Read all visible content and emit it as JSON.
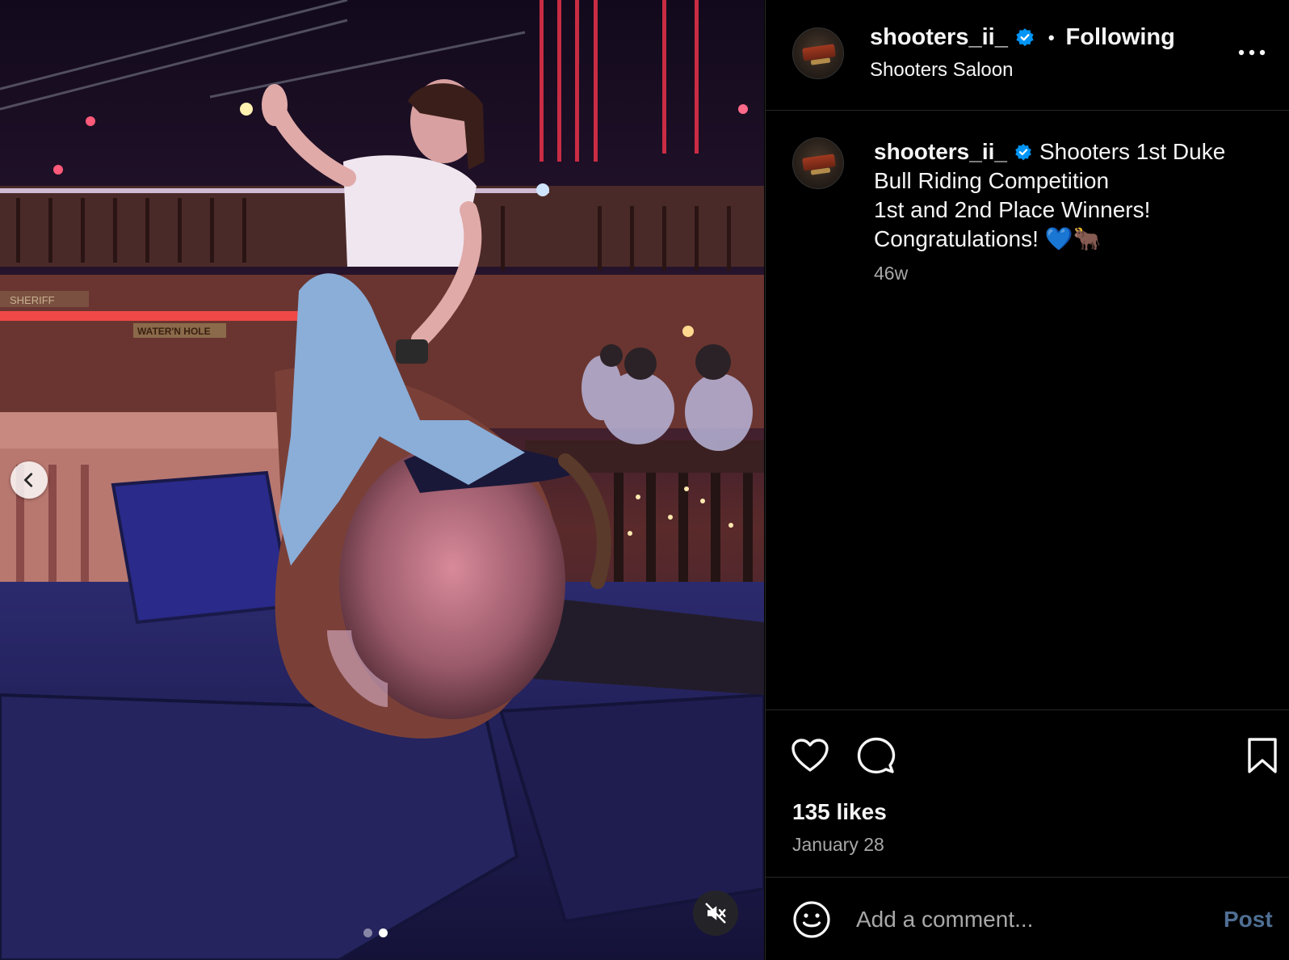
{
  "post": {
    "media": {
      "description_icon": "video-frame",
      "prev_icon": "chevron-left-icon",
      "mute_icon": "speaker-muted-icon",
      "dots": {
        "count": 2,
        "active_index": 1
      },
      "sign_texts": [
        "SHERIFF",
        "WATER'N HOLE"
      ]
    },
    "header": {
      "username": "shooters_ii_",
      "separator": "•",
      "follow_status": "Following",
      "location": "Shooters Saloon",
      "more_icon": "more-horizontal-icon"
    },
    "caption": {
      "username": "shooters_ii_",
      "line1": "Shooters 1st Duke",
      "line2": "Bull Riding Competition",
      "line3": "1st and 2nd Place Winners!",
      "line4": "Congratulations! 💙🐂",
      "time_ago": "46w"
    },
    "actions": {
      "likes": "135 likes",
      "date": "January 28"
    },
    "comment_box": {
      "placeholder": "Add a comment...",
      "post_label": "Post"
    },
    "colors": {
      "background": "#000000",
      "verified_blue": "#0095f6",
      "secondary_text": "#a8a8a8",
      "post_button_disabled": "#4f6f94"
    }
  }
}
